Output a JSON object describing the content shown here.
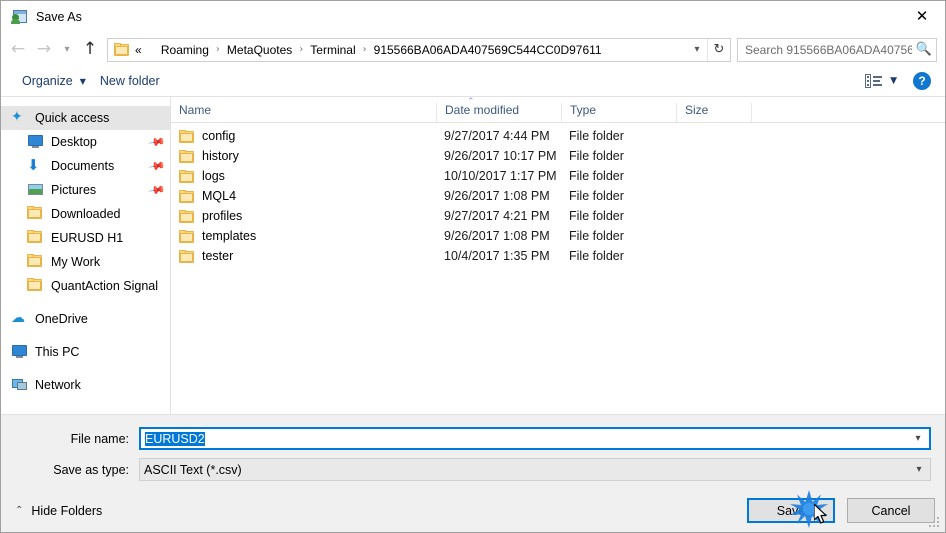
{
  "window": {
    "title": "Save As",
    "icon": "save-as-icon",
    "close_label": "✕"
  },
  "nav": {
    "back_icon": "arrow-left-icon",
    "forward_icon": "arrow-right-icon",
    "recent_icon": "chevron-down-icon",
    "up_icon": "arrow-up-icon",
    "breadcrumb_lead": "«",
    "breadcrumbs": [
      "Roaming",
      "MetaQuotes",
      "Terminal",
      "915566BA06ADA407569C544CC0D97611"
    ],
    "breadcrumb_separator": "›",
    "dropdown_icon": "chevron-down-icon",
    "refresh_icon": "refresh-icon",
    "refresh_glyph": "↻"
  },
  "search": {
    "placeholder": "Search 915566BA06ADA40756...",
    "icon": "search-icon"
  },
  "toolbar": {
    "organize_label": "Organize",
    "organize_caret": "▼",
    "new_folder_label": "New folder",
    "view_caret": "▼",
    "help_label": "?"
  },
  "sidebar": {
    "items": [
      {
        "label": "Quick access",
        "icon": "star-icon",
        "selected": true,
        "indent": false,
        "pinned": false
      },
      {
        "label": "Desktop",
        "icon": "monitor-icon",
        "selected": false,
        "indent": true,
        "pinned": true
      },
      {
        "label": "Documents",
        "icon": "download-icon",
        "selected": false,
        "indent": true,
        "pinned": true
      },
      {
        "label": "Pictures",
        "icon": "picture-icon",
        "selected": false,
        "indent": true,
        "pinned": true
      },
      {
        "label": "Downloaded",
        "icon": "folder-icon",
        "selected": false,
        "indent": true,
        "pinned": false
      },
      {
        "label": "EURUSD H1",
        "icon": "folder-icon",
        "selected": false,
        "indent": true,
        "pinned": false
      },
      {
        "label": "My Work",
        "icon": "folder-icon",
        "selected": false,
        "indent": true,
        "pinned": false
      },
      {
        "label": "QuantAction Signal",
        "icon": "folder-icon",
        "selected": false,
        "indent": true,
        "pinned": false
      },
      {
        "label": "OneDrive",
        "icon": "cloud-icon",
        "selected": false,
        "indent": false,
        "pinned": false,
        "gap_before": true
      },
      {
        "label": "This PC",
        "icon": "monitor-icon",
        "selected": false,
        "indent": false,
        "pinned": false,
        "gap_before": true
      },
      {
        "label": "Network",
        "icon": "network-icon",
        "selected": false,
        "indent": false,
        "pinned": false,
        "gap_before": true
      }
    ]
  },
  "filelist": {
    "columns": [
      "Name",
      "Date modified",
      "Type",
      "Size"
    ],
    "sort_caret": "⌃",
    "rows": [
      {
        "name": "config",
        "date": "9/27/2017 4:44 PM",
        "type": "File folder",
        "size": ""
      },
      {
        "name": "history",
        "date": "9/26/2017 10:17 PM",
        "type": "File folder",
        "size": ""
      },
      {
        "name": "logs",
        "date": "10/10/2017 1:17 PM",
        "type": "File folder",
        "size": ""
      },
      {
        "name": "MQL4",
        "date": "9/26/2017 1:08 PM",
        "type": "File folder",
        "size": ""
      },
      {
        "name": "profiles",
        "date": "9/27/2017 4:21 PM",
        "type": "File folder",
        "size": ""
      },
      {
        "name": "templates",
        "date": "9/26/2017 1:08 PM",
        "type": "File folder",
        "size": ""
      },
      {
        "name": "tester",
        "date": "10/4/2017 1:35 PM",
        "type": "File folder",
        "size": ""
      }
    ]
  },
  "form": {
    "file_name_label": "File name:",
    "file_name_value": "EURUSD2",
    "file_name_selected": true,
    "save_as_type_label": "Save as type:",
    "save_as_type_value": "ASCII Text (*.csv)",
    "dropdown_icon": "chevron-down-icon"
  },
  "footer": {
    "hide_folders_label": "Hide Folders",
    "hide_folders_caret": "⌃",
    "save_label": "Save",
    "cancel_label": "Cancel"
  },
  "colors": {
    "accent": "#0078d7",
    "folder": "#fdd87d",
    "crumb_text": "#000000",
    "header_text": "#3c5a80",
    "selection": "#0078d7"
  }
}
